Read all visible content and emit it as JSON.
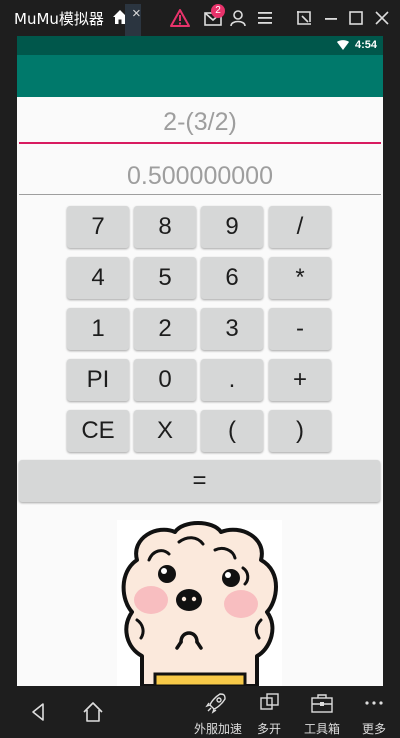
{
  "window": {
    "title": "MuMu模拟器",
    "close_glyph": "×",
    "notification_count": "2",
    "toolbar_icons": [
      "home-icon",
      "alert-icon",
      "mail-icon",
      "account-icon",
      "menu-icon",
      "screenshot-icon",
      "minimize-icon",
      "maximize-icon",
      "close-icon"
    ]
  },
  "status": {
    "time": "4:54"
  },
  "calculator": {
    "expression": "2-(3/2)",
    "result": "0.500000000",
    "keys": [
      [
        "7",
        "8",
        "9",
        "/"
      ],
      [
        "4",
        "5",
        "6",
        "*"
      ],
      [
        "1",
        "2",
        "3",
        "-"
      ],
      [
        "PI",
        "0",
        ".",
        "+"
      ],
      [
        "CE",
        "X",
        "(",
        ")"
      ]
    ],
    "equals": "="
  },
  "bottom_bar": {
    "items": [
      {
        "label": "外服加速",
        "icon": "rocket-icon"
      },
      {
        "label": "多开",
        "icon": "multi-window-icon"
      },
      {
        "label": "工具箱",
        "icon": "toolbox-icon"
      },
      {
        "label": "更多",
        "icon": "more-icon"
      }
    ]
  },
  "colors": {
    "status_bar": "#00574b",
    "app_bar": "#00796b",
    "accent": "#d81b60",
    "key_bg": "#d6d7d7"
  }
}
